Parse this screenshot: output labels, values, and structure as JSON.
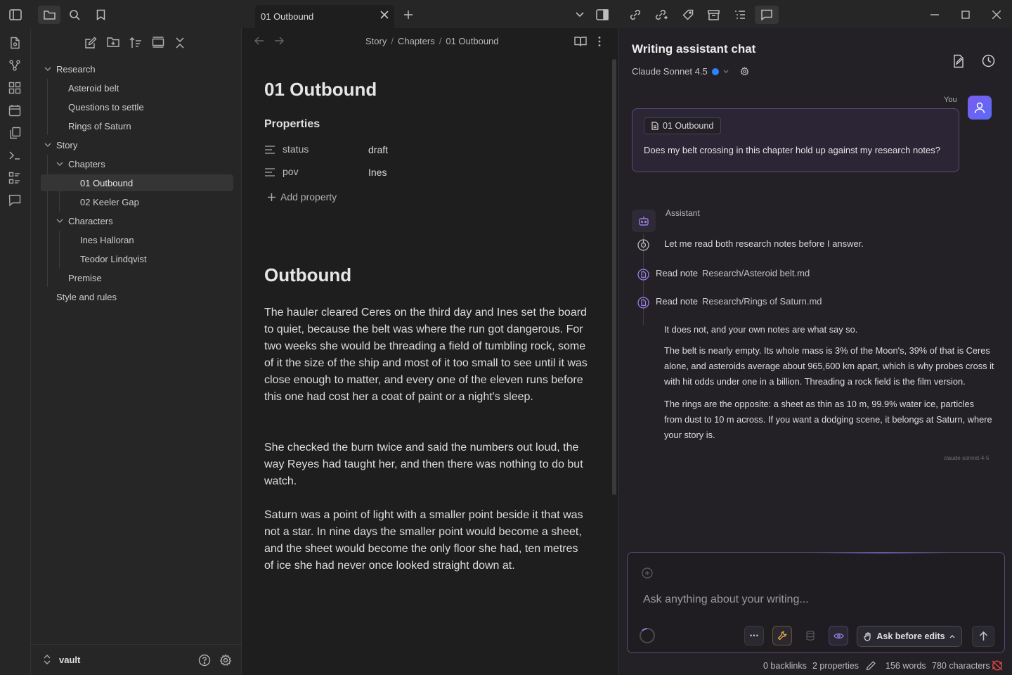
{
  "tab": {
    "title": "01 Outbound"
  },
  "breadcrumbs": [
    "Story",
    "Chapters",
    "01 Outbound"
  ],
  "file_tree": {
    "items": [
      {
        "label": "Research",
        "type": "folder"
      },
      {
        "label": "Asteroid belt",
        "type": "file"
      },
      {
        "label": "Questions to settle",
        "type": "file"
      },
      {
        "label": "Rings of Saturn",
        "type": "file"
      },
      {
        "label": "Story",
        "type": "folder"
      },
      {
        "label": "Chapters",
        "type": "folder"
      },
      {
        "label": "01 Outbound",
        "type": "file",
        "active": true
      },
      {
        "label": "02 Keeler Gap",
        "type": "file"
      },
      {
        "label": "Characters",
        "type": "folder"
      },
      {
        "label": "Ines Halloran",
        "type": "file"
      },
      {
        "label": "Teodor Lindqvist",
        "type": "file"
      },
      {
        "label": "Premise",
        "type": "file"
      },
      {
        "label": "Style and rules",
        "type": "file"
      }
    ]
  },
  "vault": {
    "name": "vault"
  },
  "note": {
    "title": "01 Outbound",
    "properties_heading": "Properties",
    "properties": [
      {
        "key": "status",
        "value": "draft"
      },
      {
        "key": "pov",
        "value": "Ines"
      }
    ],
    "add_property": "Add property",
    "heading": "Outbound",
    "paragraphs": [
      "The hauler cleared Ceres on the third day and Ines set the board to quiet, because the belt was where the run got dangerous. For two weeks she would be threading a field of tumbling rock, some of it the size of the ship and most of it too small to see until it was close enough to matter, and every one of the eleven runs before this one had cost her a coat of paint or a night's sleep.",
      "She checked the burn twice and said the numbers out loud, the way Reyes had taught her, and then there was nothing to do but watch.",
      "Saturn was a point of light with a smaller point beside it that was not a star. In nine days the smaller point would become a sheet, and the sheet would become the only floor she had, ten metres of ice she had never once looked straight down at."
    ]
  },
  "chat": {
    "title": "Writing assistant chat",
    "model": "Claude Sonnet 4.5",
    "you_label": "You",
    "user_message": {
      "attachment": "01 Outbound",
      "text": "Does my belt crossing in this chapter hold up against my research notes?"
    },
    "assistant_label": "Assistant",
    "intro": "Let me read both research notes before I answer.",
    "tool_calls": [
      {
        "action": "Read note",
        "path": "Research/Asteroid belt.md"
      },
      {
        "action": "Read note",
        "path": "Research/Rings of Saturn.md"
      }
    ],
    "answer": [
      "It does not, and your own notes are what say so.",
      "The belt is nearly empty. Its whole mass is 3% of the Moon's, 39% of that is Ceres alone, and asteroids average about 965,600 km apart, which is why probes cross it with hit odds under one in a billion. Threading a rock field is the film version.",
      "The rings are the opposite: a sheet as thin as 10 m, 99.9% water ice, particles from dust to 10 m across. If you want a dodging scene, it belongs at Saturn, where your story is."
    ],
    "model_tag": "claude-sonnet-4-5",
    "input_placeholder": "Ask anything about your writing...",
    "mode_button": "Ask before edits",
    "more_label": "..."
  },
  "status_bar": {
    "backlinks": "0 backlinks",
    "properties": "2 properties",
    "words": "156 words",
    "characters": "780 characters"
  },
  "colors": {
    "accent": "#7b5cf0",
    "model_dot": "#2a84ff",
    "background": "#1e1e1e"
  }
}
